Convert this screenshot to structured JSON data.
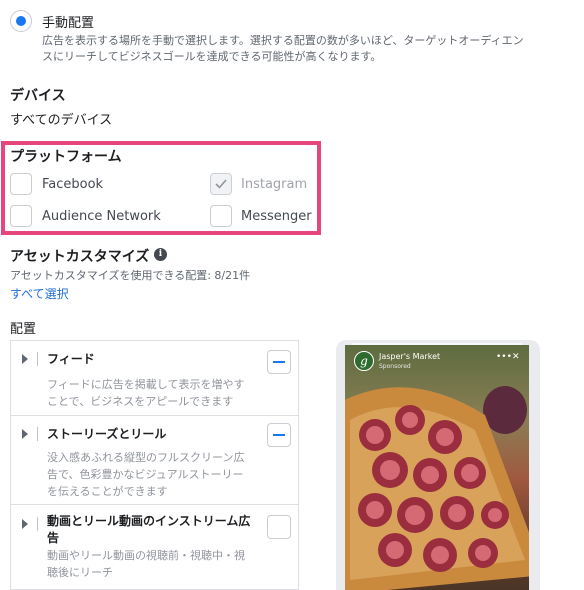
{
  "manual": {
    "title": "手動配置",
    "desc_line1": "広告を表示する場所を手動で選択します。選択する配置の数が多いほど、ターゲットオーディエン",
    "desc_line2": "スにリーチしてビジネスゴールを達成できる可能性が高くなります。"
  },
  "device": {
    "heading": "デバイス",
    "value": "すべてのデバイス"
  },
  "platform": {
    "heading": "プラットフォーム",
    "options": [
      {
        "label": "Facebook",
        "checked": false,
        "disabled": false
      },
      {
        "label": "Instagram",
        "checked": true,
        "disabled": true
      },
      {
        "label": "Audience Network",
        "checked": false,
        "disabled": false
      },
      {
        "label": "Messenger",
        "checked": false,
        "disabled": false
      }
    ],
    "highlight_color": "#e6457e"
  },
  "asset": {
    "heading": "アセットカスタマイズ",
    "info_icon": "i",
    "note": "アセットカスタマイズを使用できる配置: 8/21件",
    "select_all": "すべて選択"
  },
  "placements": {
    "heading": "配置",
    "rows": [
      {
        "title": "フィード",
        "desc1": "フィードに広告を掲載して表示を増やす",
        "desc2": "ことで、ビジネスをアピールできます",
        "selected": true
      },
      {
        "title": "ストーリーズとリール",
        "desc1": "没入感あふれる縦型のフルスクリーン広",
        "desc2": "告で、色彩豊かなビジュアルストーリー",
        "desc3": "を伝えることができます",
        "selected": true
      },
      {
        "title1": "動画とリール動画のインストリーム広",
        "title2": "告",
        "desc1": "動画やリール動画の視聴前・視聴中・視",
        "desc2": "聴後にリーチ",
        "selected": false
      }
    ]
  },
  "preview": {
    "brand": "Jasper's Market",
    "sponsored": "Sponsored",
    "avatar_letter": "g",
    "more_glyph": "•••",
    "close_glyph": "✕"
  },
  "colors": {
    "accent": "#1877f2",
    "link": "#216fdb"
  }
}
